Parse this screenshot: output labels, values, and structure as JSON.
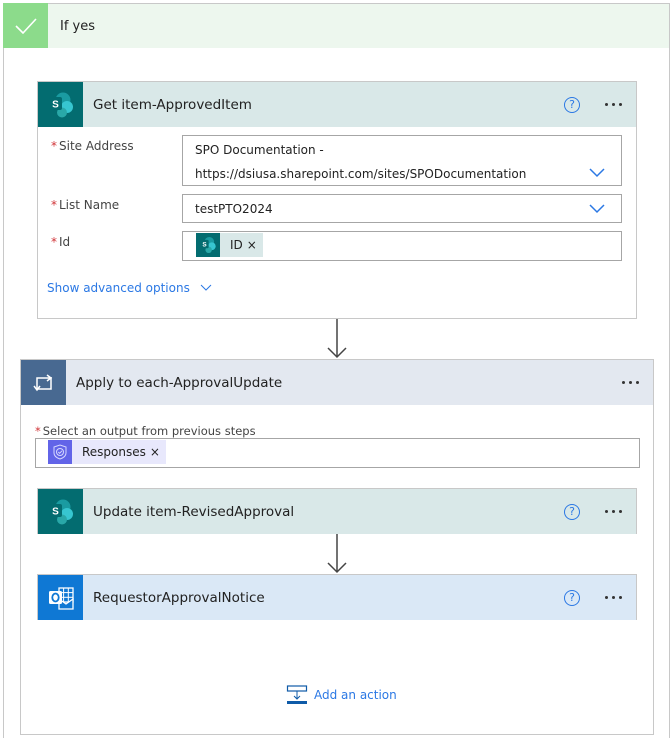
{
  "condition": {
    "title": "If yes",
    "icon": "checkmark-icon",
    "accent": "#8cdb8b"
  },
  "get_item": {
    "title": "Get item-ApprovedItem",
    "icon": "sharepoint-icon",
    "help_icon": "question-circle-icon",
    "more_icon": "ellipsis-icon",
    "fields": {
      "site_address": {
        "label": "Site Address",
        "value_line1": "SPO Documentation -",
        "value_line2": "https://dsiusa.sharepoint.com/sites/SPODocumentation"
      },
      "list_name": {
        "label": "List Name",
        "value": "testPTO2024"
      },
      "id": {
        "label": "Id",
        "token": "ID",
        "token_remove": "×"
      }
    },
    "required_marker": "*",
    "show_advanced": "Show advanced options"
  },
  "apply_to_each": {
    "title": "Apply to each-ApprovalUpdate",
    "icon": "loop-icon",
    "more_icon": "ellipsis-icon",
    "output_label": "Select an output from previous steps",
    "required_marker": "*",
    "token": "Responses",
    "token_remove": "×"
  },
  "update_item": {
    "title": "Update item-RevisedApproval",
    "icon": "sharepoint-icon"
  },
  "notice": {
    "title": "RequestorApprovalNotice",
    "icon": "outlook-icon"
  },
  "add_action": {
    "label": "Add an action",
    "icon": "add-action-icon"
  },
  "colors": {
    "sharepoint": "#036c70",
    "loop": "#486991",
    "outlook": "#0f78d4",
    "link": "#2b78e4",
    "approvals": "#6264e8"
  }
}
